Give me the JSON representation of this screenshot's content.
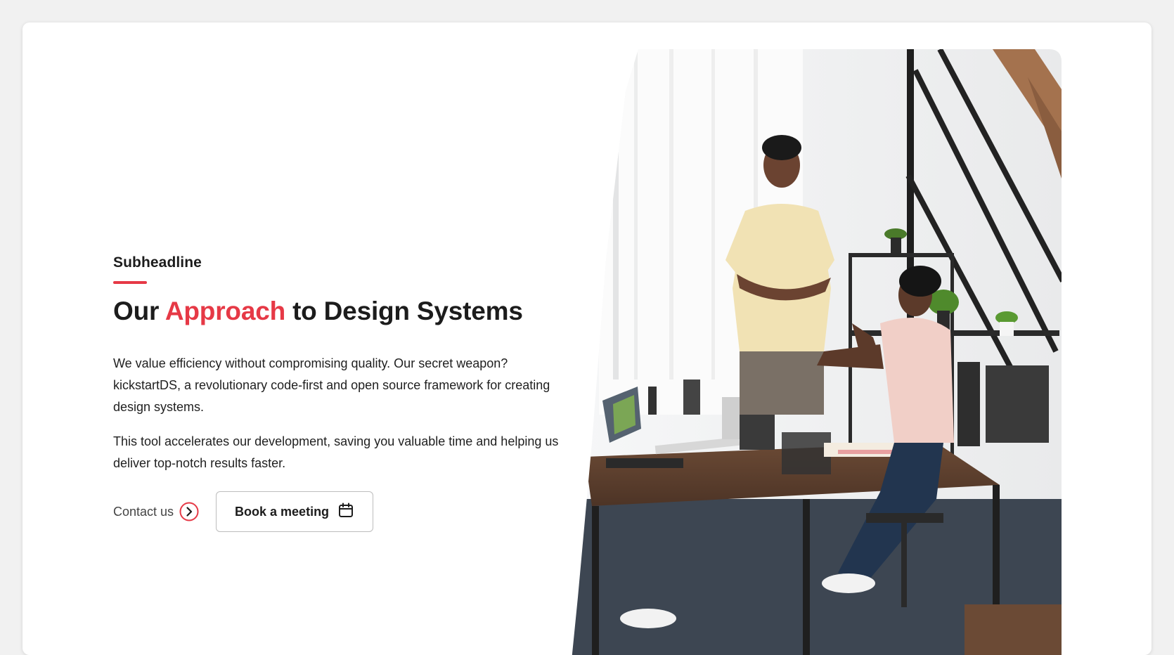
{
  "section": {
    "subheadline": "Subheadline",
    "headline": {
      "before": "Our ",
      "highlight": "Approach",
      "after": " to Design Systems"
    },
    "paragraphs": [
      "We value efficiency without compromising quality. Our secret weapon? kickstartDS, a revolutionary code-first and open source framework for creating design systems.",
      "This tool accelerates our development, saving you valuable time and helping us deliver top-notch results faster."
    ],
    "contact_label": "Contact us",
    "book_label": "Book a meeting"
  },
  "colors": {
    "accent": "#e63946",
    "text": "#1c1c1c",
    "muted": "#444444",
    "border": "#bdbdbd"
  },
  "icons": {
    "contact": "chevron-right-circle-icon",
    "book": "calendar-icon"
  },
  "image": {
    "subject": "office-photo-two-men-talking"
  }
}
